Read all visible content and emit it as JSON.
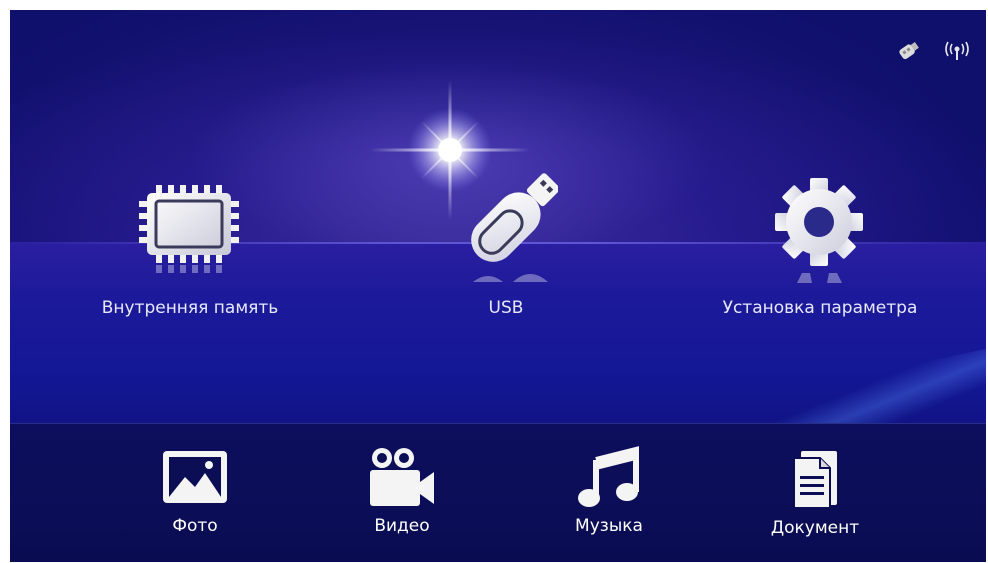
{
  "status": {
    "icons": [
      "usb-plug-icon",
      "wifi-broadcast-icon"
    ]
  },
  "main_menu": {
    "items": [
      {
        "label": "Внутренняя память",
        "icon": "memory-chip-icon"
      },
      {
        "label": "USB",
        "icon": "usb-drive-icon"
      },
      {
        "label": "Установка параметра",
        "icon": "gear-icon"
      }
    ]
  },
  "media_bar": {
    "items": [
      {
        "label": "Фото",
        "icon": "photo-icon"
      },
      {
        "label": "Видео",
        "icon": "video-camera-icon"
      },
      {
        "label": "Музыка",
        "icon": "music-note-icon"
      },
      {
        "label": "Документ",
        "icon": "document-icon"
      }
    ]
  },
  "colors": {
    "background": "#1c1a9a",
    "bottom_bar": "#0b0d55",
    "label": "#ffffff"
  }
}
